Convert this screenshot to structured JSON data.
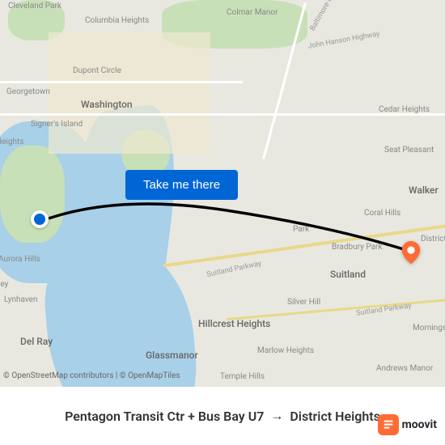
{
  "map": {
    "labels": {
      "cleveland_park": "Cleveland Park",
      "columbia_heights": "Columbia Heights",
      "colmar_manor": "Colmar Manor",
      "dupont_circle": "Dupont Circle",
      "georgetown": "Georgetown",
      "washington": "Washington",
      "signers_island": "Signer's Island",
      "cedar_heights": "Cedar Heights",
      "seat_pleasant": "Seat Pleasant",
      "walker": "Walker",
      "coral_hills": "Coral Hills",
      "bradbury_park": "Bradbury Park",
      "district": "District",
      "suitland": "Suitland",
      "silver_hill": "Silver Hill",
      "hillcrest_heights": "Hillcrest Heights",
      "mornings": "Mornings",
      "glassmanor": "Glassmanor",
      "marlow_heights": "Marlow Heights",
      "temple_hills": "Temple Hills",
      "andrews_manor": "Andrews Manor",
      "aurora_hills": "Aurora Hills",
      "lynhaven": "Lynhaven",
      "del_ray": "Del Ray",
      "heights": "Heights",
      "ley": "ley",
      "park": "Park"
    },
    "roads": {
      "baltimore_wash": "Baltimore-Wash",
      "john_hanson": "John Hanson Highway",
      "suitland_pkwy": "Suitland Parkway",
      "suitland_pkwy2": "Suitland Parkway"
    },
    "attribution": {
      "osm": "© OpenStreetMap contributors",
      "omt": "© OpenMapTiles"
    }
  },
  "cta": {
    "label": "Take me there"
  },
  "route": {
    "origin": "Pentagon Transit Ctr + Bus Bay U7",
    "arrow": "→",
    "destination": "District Heights"
  },
  "branding": {
    "name": "moovit"
  },
  "colors": {
    "primary": "#0066d6",
    "brand": "#ff6b35"
  }
}
